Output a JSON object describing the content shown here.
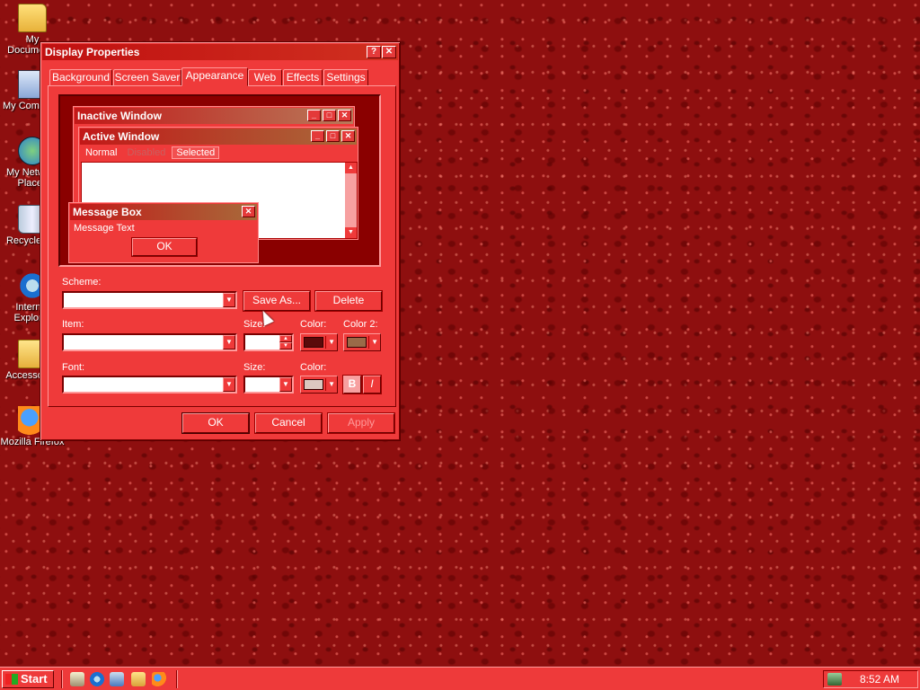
{
  "desktop": {
    "icons": [
      {
        "label": "My Documents",
        "icon": "folder-documents-icon"
      },
      {
        "label": "My Computer",
        "icon": "computer-icon"
      },
      {
        "label": "My Network\nPlaces",
        "icon": "network-places-icon"
      },
      {
        "label": "Recycle Bin",
        "icon": "recycle-bin-icon"
      },
      {
        "label": "Internet\nExplorer",
        "icon": "internet-explorer-icon"
      },
      {
        "label": "Accessories",
        "icon": "folder-icon"
      },
      {
        "label": "Mozilla Firefox",
        "icon": "firefox-icon"
      }
    ]
  },
  "window": {
    "title": "Display Properties",
    "help_label": "?",
    "close_label": "✕",
    "tabs": [
      {
        "label": "Background"
      },
      {
        "label": "Screen Saver"
      },
      {
        "label": "Appearance",
        "active": true
      },
      {
        "label": "Web"
      },
      {
        "label": "Effects"
      },
      {
        "label": "Settings"
      }
    ],
    "preview": {
      "inactive_title": "Inactive Window",
      "active_title": "Active Window",
      "menu": {
        "normal": "Normal",
        "disabled": "Disabled",
        "selected": "Selected"
      },
      "msgbox_title": "Message Box",
      "msgbox_text": "Message Text",
      "msgbox_ok": "OK"
    },
    "labels": {
      "scheme": "Scheme:",
      "item": "Item:",
      "size": "Size:",
      "color": "Color:",
      "color2": "Color 2:",
      "font": "Font:",
      "font_size": "Size:",
      "font_color": "Color:"
    },
    "values": {
      "scheme": "",
      "item": "",
      "size": "",
      "font": "",
      "font_size": ""
    },
    "buttons": {
      "save_as": "Save As...",
      "delete": "Delete",
      "bold": "B",
      "italic": "I",
      "ok": "OK",
      "cancel": "Cancel",
      "apply": "Apply"
    },
    "colors": {
      "item_color": "#5a0a0a",
      "item_color2": "#9a6a48",
      "font_color": "#dcc8c0",
      "active_title": "#a86a3a",
      "inactive_title": "#b87a5a"
    }
  },
  "taskbar": {
    "start_label": "Start",
    "quick_launch": [
      "show-desktop-icon",
      "internet-explorer-icon",
      "outlook-icon",
      "search-icon",
      "firefox-icon"
    ],
    "clock": "8:52 AM"
  }
}
